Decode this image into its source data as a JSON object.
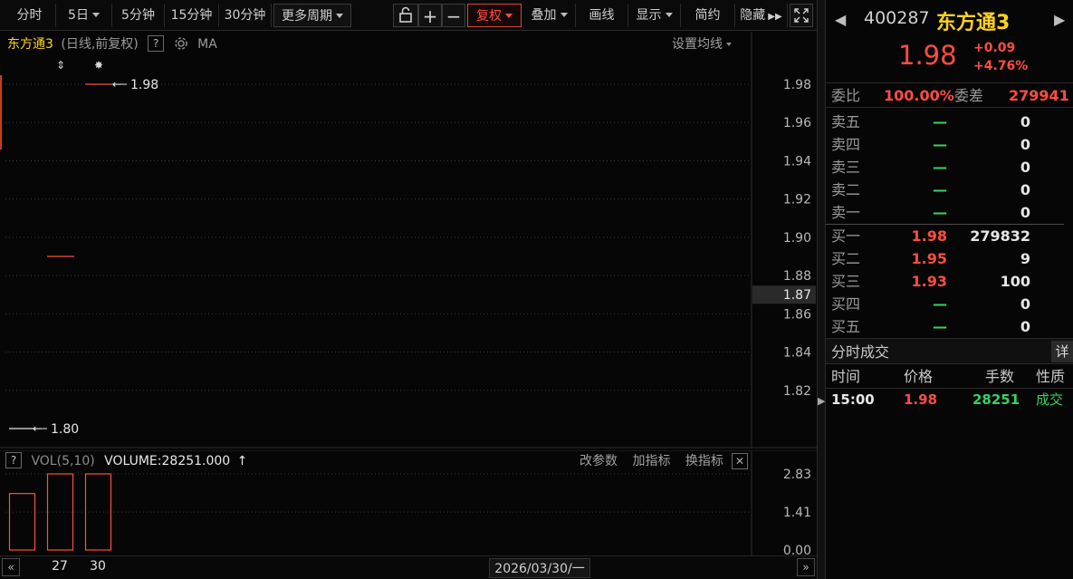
{
  "toolbar": {
    "periods": [
      "分时",
      "5日",
      "5分钟",
      "15分钟",
      "30分钟",
      "更多周期"
    ],
    "lock_icon": "lock-icon",
    "zoom_in": "+",
    "zoom_out": "−",
    "fuquan": "复权",
    "overlay": "叠加",
    "draw": "画线",
    "display": "显示",
    "simple": "简约",
    "hide": "隐藏",
    "fullscreen_icon": "fullscreen-icon"
  },
  "chart_header": {
    "name": "东方通3",
    "subtitle": "(日线,前复权)",
    "help": "?",
    "ma": "MA",
    "ma_settings": "设置均线"
  },
  "volume_header": {
    "help": "?",
    "indicator": "VOL(5,10)",
    "value": "VOLUME:28251.000",
    "modify": "改参数",
    "add": "加指标",
    "change": "换指标",
    "close": "✕"
  },
  "bottom": {
    "date": "2026/03/30/一",
    "prev": "«",
    "next": "»"
  },
  "colors": {
    "up": "#ff4d40",
    "down": "#3ad060",
    "name": "#ffd21e",
    "grid": "#3a3a3a"
  },
  "chart_data": {
    "type": "candlestick",
    "price_axis": {
      "ticks": [
        "1.98",
        "1.96",
        "1.94",
        "1.92",
        "1.90",
        "1.88",
        "1.86",
        "1.84",
        "1.82"
      ],
      "ylim": [
        1.8,
        1.98
      ],
      "current": "1.87"
    },
    "candles": [
      {
        "index": 0,
        "open": 1.8,
        "close": 1.8,
        "high": 1.8,
        "low": 1.8
      },
      {
        "index": 1,
        "open": 1.89,
        "close": 1.89,
        "high": 1.89,
        "low": 1.89
      },
      {
        "index": 2,
        "open": 1.98,
        "close": 1.98,
        "high": 1.98,
        "low": 1.98
      }
    ],
    "markers": [
      "⇕",
      "✸"
    ],
    "max_label": "1.98",
    "min_label": "1.80",
    "volume": {
      "values": [
        2.1,
        2.83,
        2.83
      ],
      "ticks": [
        "2.83",
        "1.41",
        "0.00"
      ],
      "ylim": [
        0,
        2.83
      ]
    },
    "x_labels": [
      "27",
      "30"
    ]
  },
  "quote": {
    "code": "400287",
    "name": "东方通3",
    "price": "1.98",
    "change": "+0.09",
    "change_pct": "+4.76%",
    "ratio_label": "委比",
    "ratio_value": "100.00%",
    "diff_label": "委差",
    "diff_value": "279941"
  },
  "order_book": {
    "sell": [
      {
        "label": "卖五",
        "price": "—",
        "volume": "0"
      },
      {
        "label": "卖四",
        "price": "—",
        "volume": "0"
      },
      {
        "label": "卖三",
        "price": "—",
        "volume": "0"
      },
      {
        "label": "卖二",
        "price": "—",
        "volume": "0"
      },
      {
        "label": "卖一",
        "price": "—",
        "volume": "0"
      }
    ],
    "buy": [
      {
        "label": "买一",
        "price": "1.98",
        "volume": "279832"
      },
      {
        "label": "买二",
        "price": "1.95",
        "volume": "9"
      },
      {
        "label": "买三",
        "price": "1.93",
        "volume": "100"
      },
      {
        "label": "买四",
        "price": "—",
        "volume": "0"
      },
      {
        "label": "买五",
        "price": "—",
        "volume": "0"
      }
    ]
  },
  "trades": {
    "title": "分时成交",
    "detail": "详",
    "columns": [
      "时间",
      "价格",
      "手数",
      "性质"
    ],
    "rows": [
      {
        "time": "15:00",
        "price": "1.98",
        "volume": "28251",
        "type": "成交"
      }
    ]
  }
}
